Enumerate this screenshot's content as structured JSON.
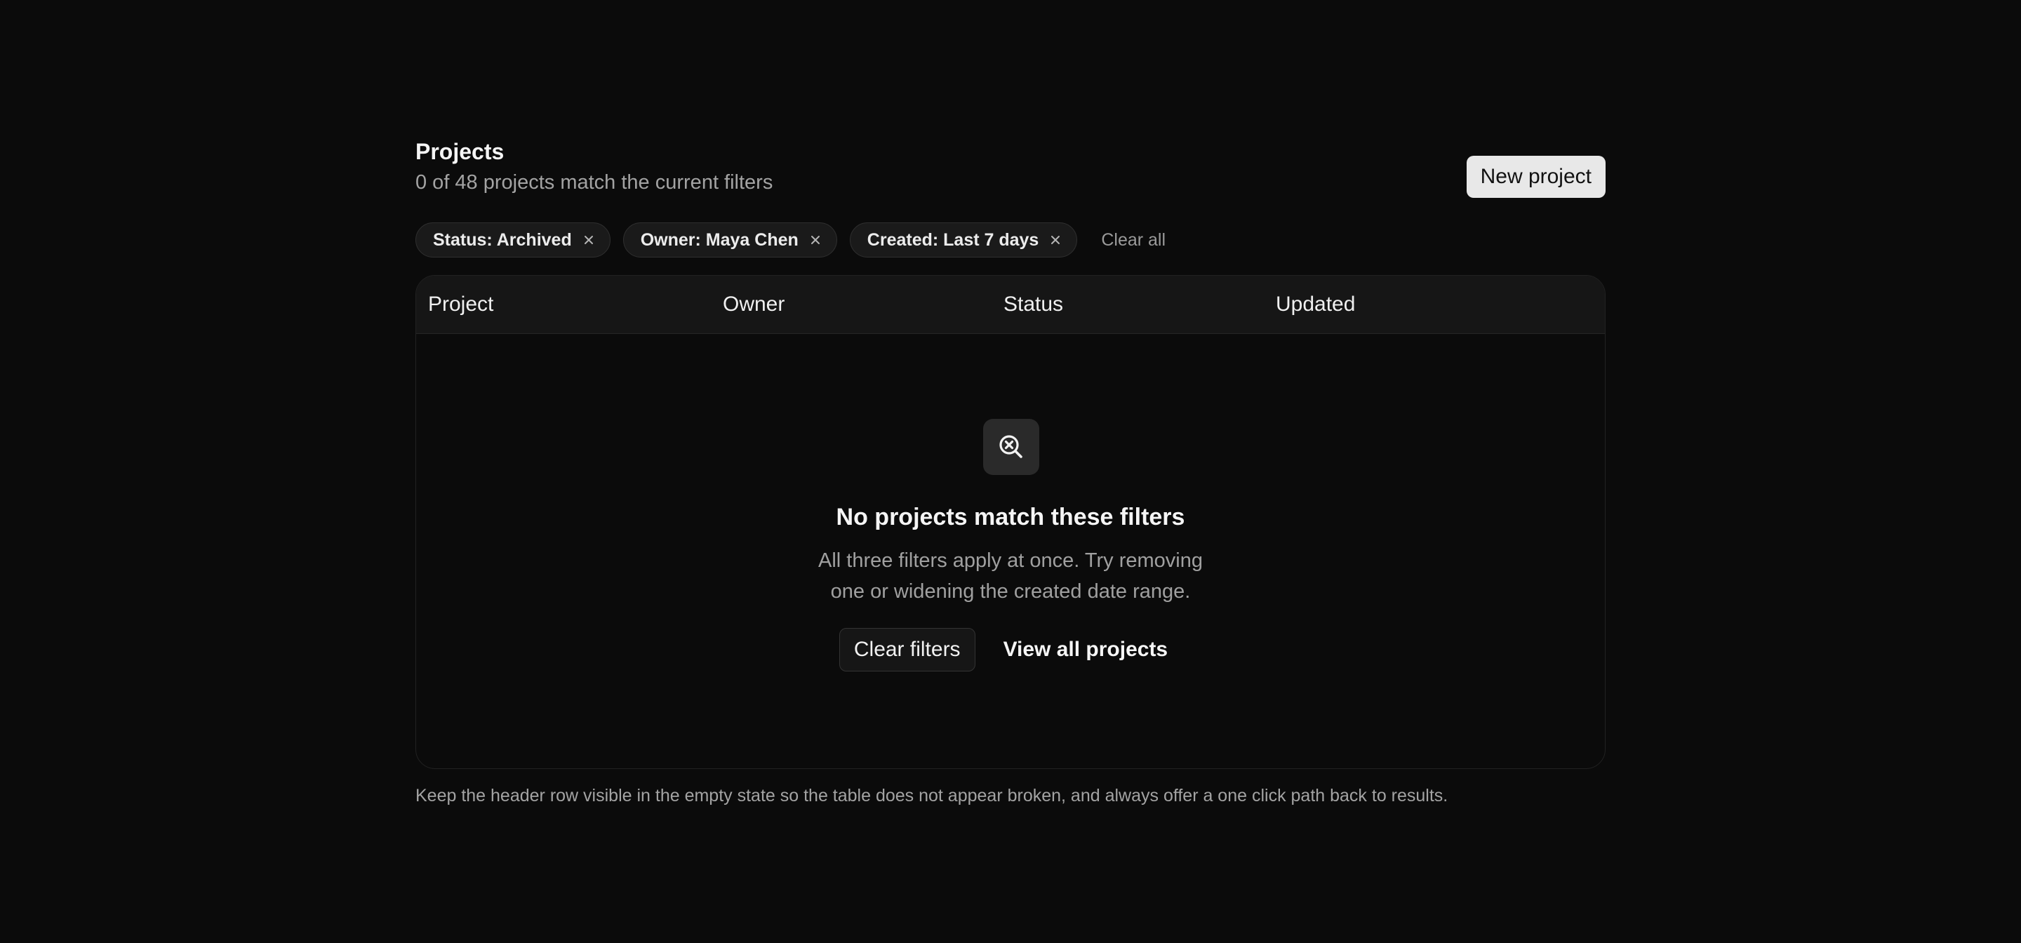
{
  "header": {
    "title": "Projects",
    "subtitle": "0 of 48 projects match the current filters",
    "new_project_label": "New project"
  },
  "filters": {
    "chips": [
      {
        "label": "Status: Archived"
      },
      {
        "label": "Owner: Maya Chen"
      },
      {
        "label": "Created: Last 7 days"
      }
    ],
    "clear_all_label": "Clear all"
  },
  "table": {
    "columns": [
      "Project",
      "Owner",
      "Status",
      "Updated"
    ]
  },
  "empty_state": {
    "icon": "search-x-icon",
    "title": "No projects match these filters",
    "description_line1": "All three filters apply at once. Try removing",
    "description_line2": "one or widening the created date range.",
    "clear_filters_label": "Clear filters",
    "view_all_label": "View all projects"
  },
  "footnote": "Keep the header row visible in the empty state so the table does not appear broken, and always offer a one click path back to results.",
  "colors": {
    "background": "#0b0b0b",
    "primary_button": "#e8e8e8",
    "muted_text": "#a3a3a3"
  }
}
